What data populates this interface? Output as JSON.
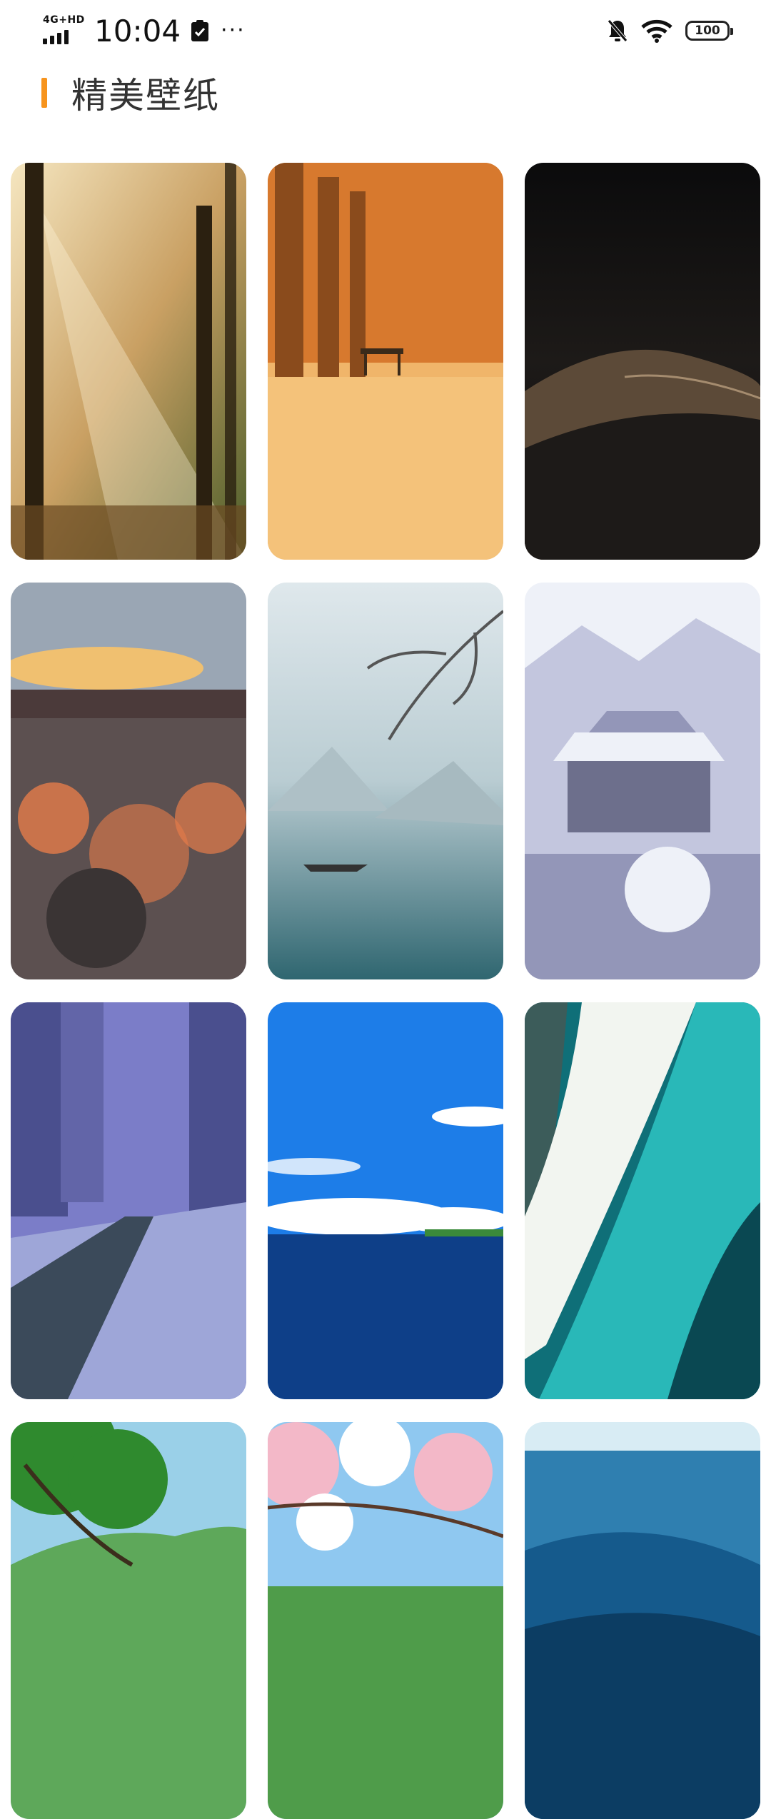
{
  "status_bar": {
    "network": "4G+HD",
    "time": "10:04",
    "more": "···",
    "battery": "100"
  },
  "header": {
    "title": "精美壁纸"
  },
  "wallpapers": [
    {
      "name": "forest-sunbeams",
      "colors": [
        "#f5e6c0",
        "#c9a063",
        "#4a5d2a",
        "#2b2010"
      ]
    },
    {
      "name": "autumn-avenue-bench",
      "colors": [
        "#f0b56a",
        "#d7792e",
        "#8a4b1c",
        "#f4c27a"
      ]
    },
    {
      "name": "dark-desert-dune",
      "colors": [
        "#0b0b0c",
        "#1d1a18",
        "#5c4a38",
        "#a58c6f"
      ]
    },
    {
      "name": "sunset-clouds",
      "colors": [
        "#9aa6b4",
        "#f0c070",
        "#5c5050",
        "#e57c4a"
      ]
    },
    {
      "name": "misty-lake-boat",
      "colors": [
        "#dfe8ec",
        "#b9ccd2",
        "#5e8f98",
        "#2f6670"
      ]
    },
    {
      "name": "snowy-temple",
      "colors": [
        "#eef1f8",
        "#c3c6de",
        "#9396b8",
        "#6d6f8c"
      ]
    },
    {
      "name": "anime-city-street",
      "colors": [
        "#7b7dc8",
        "#4a4f8e",
        "#9ea6d8",
        "#3b4a5a"
      ]
    },
    {
      "name": "blue-sky-ocean",
      "colors": [
        "#1d7de8",
        "#63aef2",
        "#ffffff",
        "#0e3f88"
      ]
    },
    {
      "name": "turquoise-wave",
      "colors": [
        "#0f6f78",
        "#29b8b8",
        "#f2f5f0",
        "#0a4852"
      ]
    },
    {
      "name": "green-tree-mountains",
      "colors": [
        "#9ad0e8",
        "#2f8a2e",
        "#5ea85a",
        "#dcecf2"
      ]
    },
    {
      "name": "cherry-blossom-sky",
      "colors": [
        "#8fc8f0",
        "#f3b8c8",
        "#ffffff",
        "#4f9c4a"
      ]
    },
    {
      "name": "deep-ocean-waves",
      "colors": [
        "#d8ecf4",
        "#2f7fb0",
        "#155a8c",
        "#0c3d63"
      ]
    }
  ]
}
